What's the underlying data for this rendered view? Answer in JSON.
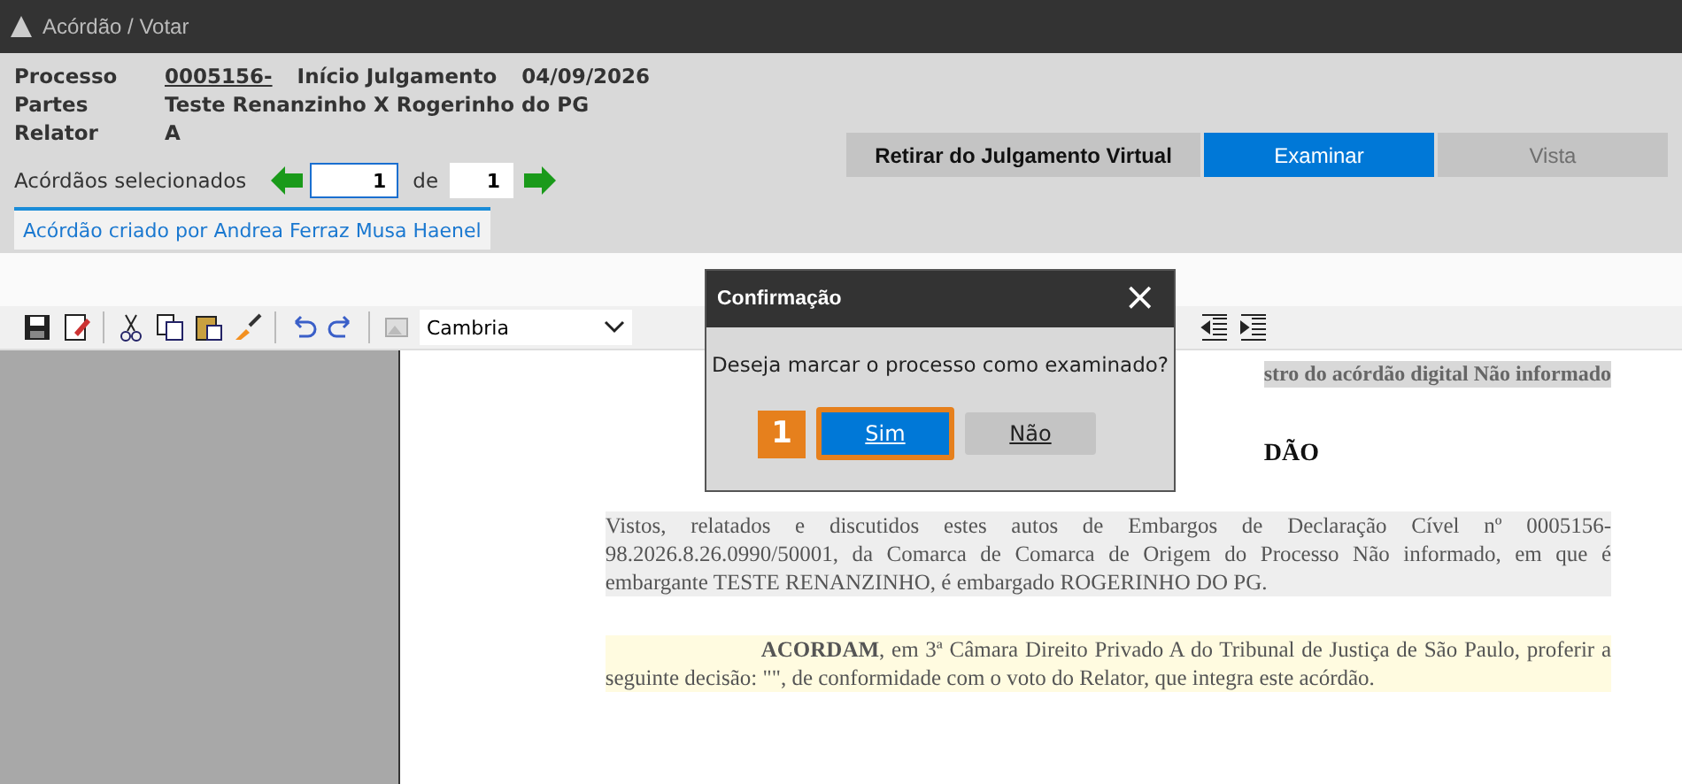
{
  "window": {
    "title": "Acórdão / Votar"
  },
  "header": {
    "fields": [
      {
        "label": "Processo",
        "value": "0005156-",
        "extra_label": "Início Julgamento",
        "extra_value": "04/09/2026",
        "link": true
      },
      {
        "label": "Partes",
        "value": "Teste Renanzinho X Rogerinho do PG",
        "link": false
      },
      {
        "label": "Relator",
        "value": "A",
        "link": false
      }
    ]
  },
  "navigator": {
    "label": "Acórdãos selecionados",
    "current": "1",
    "separator": "de",
    "total": "1"
  },
  "actions": [
    {
      "label": "Retirar do Julgamento Virtual",
      "kind": "secondary",
      "disabled": false
    },
    {
      "label": "Examinar",
      "kind": "primary",
      "disabled": false
    },
    {
      "label": "Vista",
      "kind": "secondary",
      "disabled": true
    }
  ],
  "tabs": [
    {
      "label": "Acórdão criado por Andrea Ferraz Musa Haenel",
      "selected": true
    }
  ],
  "toolbar": {
    "font": "Cambria"
  },
  "document": {
    "top_line": "stro do acórdão digital Não informado",
    "heading": "DÃO",
    "paragraphs": [
      "Vistos, relatados e discutidos estes autos de Embargos de Declaração Cível nº 0005156-98.2026.8.26.0990/50001, da Comarca de Comarca de Origem do Processo Não informado, em que é embargante TESTE RENANZINHO, é embargado ROGERINHO DO PG.",
      "**ACORDAM**, em 3ª Câmara Direito Privado A do Tribunal de Justiça de São Paulo, proferir a seguinte decisão: \"\", de conformidade com o voto do Relator, que integra este acórdão."
    ]
  },
  "dialog": {
    "title": "Confirmação",
    "close": "×",
    "message": "Deseja marcar o processo como examinado?",
    "buttons": [
      {
        "label": "Sim",
        "selected": true,
        "step": "1"
      },
      {
        "label": "Não",
        "selected": false
      }
    ]
  }
}
